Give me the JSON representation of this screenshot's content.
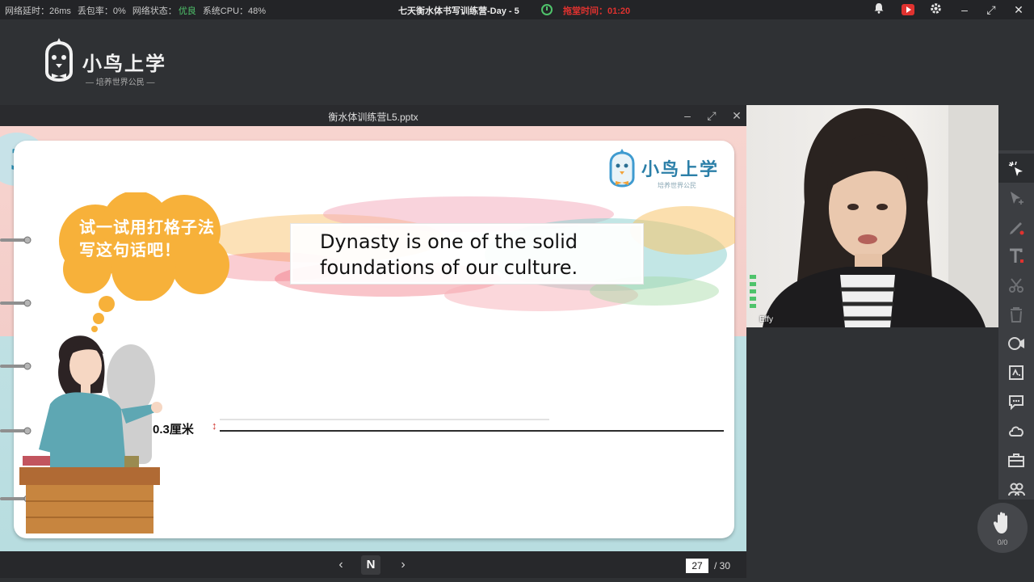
{
  "status_bar": {
    "latency": "网络延时：26ms",
    "packet_loss": "丢包率：0%",
    "network_label": "网络状态：",
    "network_value": "优良",
    "cpu": "系统CPU：48%",
    "session_title": "七天衡水体书写训练营-Day - 5",
    "timer_label": "拖堂时间：",
    "timer_value": "01:20"
  },
  "brand": {
    "name": "小鸟上学",
    "tagline": "— 培养世界公民 —"
  },
  "slide_window": {
    "file_name": "衡水体训练营L5.pptx"
  },
  "slide": {
    "step_number": "3",
    "logo_name": "小鸟上学",
    "logo_tagline": "培养世界公民",
    "prompt": "试一试用打格子法写这句话吧！",
    "sentence": "Dynasty is one of the solid foundations of our culture.",
    "ruler_label": "0.3厘米",
    "ruler_arrow": "↕"
  },
  "pager": {
    "prev": "‹",
    "current_icon": "N",
    "next": "›",
    "current_page": "27",
    "total": "/ 30"
  },
  "video": {
    "participant_name": "Effy"
  },
  "hand_raise": {
    "count": "0/0"
  },
  "colors": {
    "good_status": "#4fc36b",
    "timer_red": "#e0322f",
    "cloud_orange": "#f7b13a",
    "slide_pink": "#f3cdc9",
    "slide_teal": "#b8dde0"
  }
}
